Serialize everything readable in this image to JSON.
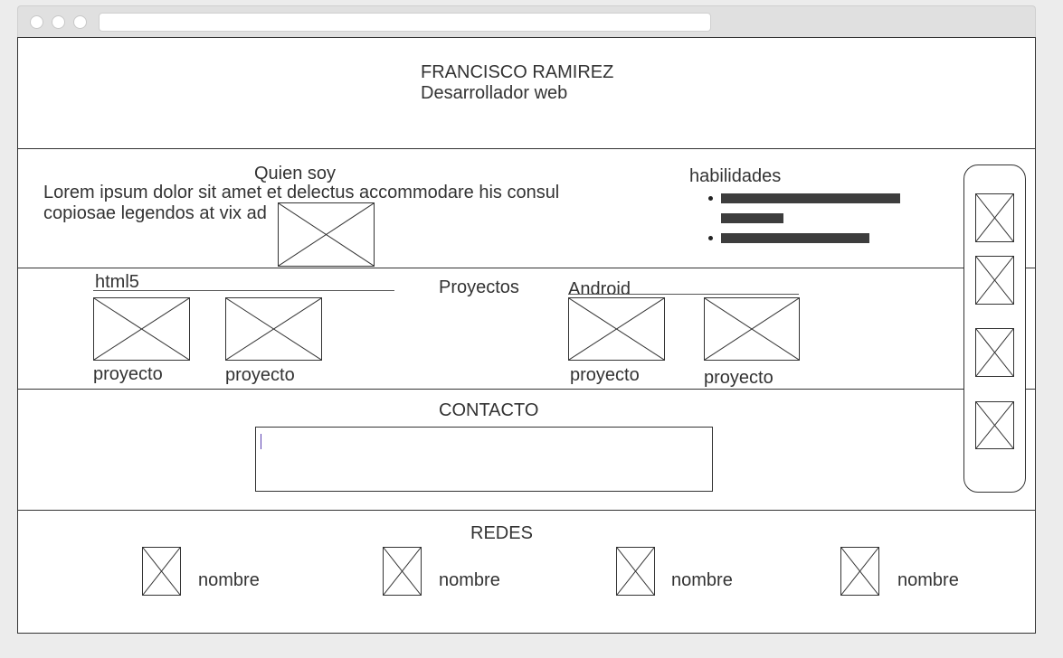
{
  "header": {
    "name": "FRANCISCO RAMIREZ",
    "subtitle": "Desarrollador web"
  },
  "about": {
    "title": "Quien soy",
    "text_line1": "Lorem ipsum dolor sit amet et delectus accommodare his consul",
    "text_line2": "copiosae legendos at vix ad"
  },
  "skills": {
    "title": "habilidades",
    "levels": [
      0.8,
      0.28,
      0.66
    ]
  },
  "projects": {
    "title": "Proyectos",
    "group_left": {
      "title": "html5",
      "items": [
        "proyecto",
        "proyecto"
      ]
    },
    "group_right": {
      "title": "Android",
      "items": [
        "proyecto",
        "proyecto"
      ]
    }
  },
  "contact": {
    "title": "CONTACTO"
  },
  "social": {
    "title": "REDES",
    "items": [
      "nombre",
      "nombre",
      "nombre",
      "nombre"
    ]
  },
  "colors": {
    "stroke": "#333333",
    "bar": "#3d3d3d",
    "caret": "#5a3fb0"
  }
}
